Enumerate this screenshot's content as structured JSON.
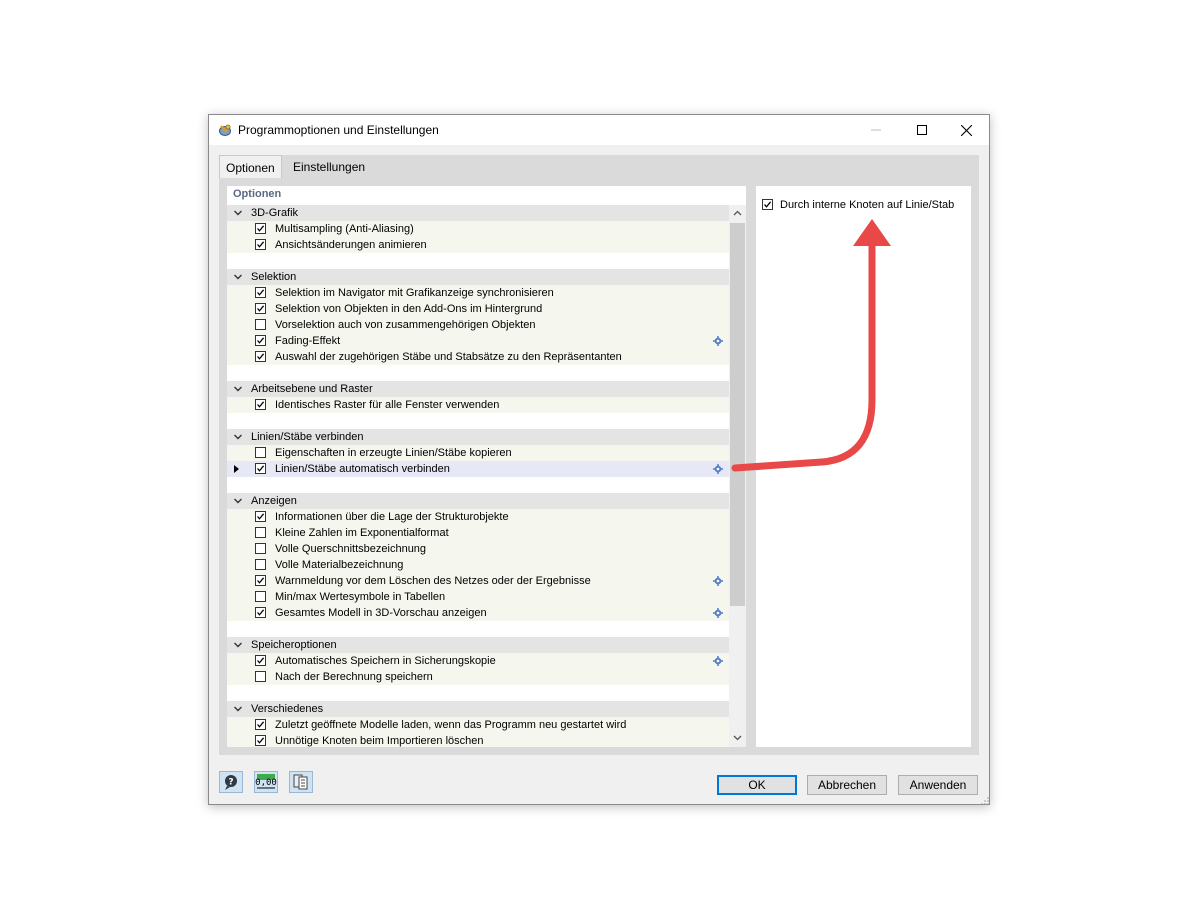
{
  "window": {
    "title": "Programmoptionen und Einstellungen"
  },
  "tabs": [
    {
      "label": "Optionen",
      "active": true
    },
    {
      "label": "Einstellungen",
      "active": false
    }
  ],
  "options_section_label": "Optionen",
  "groups": [
    {
      "title": "3D-Grafik",
      "items": [
        {
          "label": "Multisampling (Anti-Aliasing)",
          "checked": true,
          "gear": false
        },
        {
          "label": "Ansichtsänderungen animieren",
          "checked": true,
          "gear": false
        }
      ]
    },
    {
      "title": "Selektion",
      "items": [
        {
          "label": "Selektion im Navigator mit Grafikanzeige synchronisieren",
          "checked": true,
          "gear": false
        },
        {
          "label": "Selektion von Objekten in den Add-Ons im Hintergrund",
          "checked": true,
          "gear": false
        },
        {
          "label": "Vorselektion auch von zusammengehörigen Objekten",
          "checked": false,
          "gear": false
        },
        {
          "label": "Fading-Effekt",
          "checked": true,
          "gear": true
        },
        {
          "label": "Auswahl der zugehörigen Stäbe und Stabsätze zu den Repräsentanten",
          "checked": true,
          "gear": false
        }
      ]
    },
    {
      "title": "Arbeitsebene und Raster",
      "items": [
        {
          "label": "Identisches Raster für alle Fenster verwenden",
          "checked": true,
          "gear": false
        }
      ]
    },
    {
      "title": "Linien/Stäbe verbinden",
      "items": [
        {
          "label": "Eigenschaften in erzeugte Linien/Stäbe kopieren",
          "checked": false,
          "gear": false
        },
        {
          "label": "Linien/Stäbe automatisch verbinden",
          "checked": true,
          "gear": true,
          "current": true
        }
      ]
    },
    {
      "title": "Anzeigen",
      "items": [
        {
          "label": "Informationen über die Lage der Strukturobjekte",
          "checked": true,
          "gear": false
        },
        {
          "label": "Kleine Zahlen im Exponentialformat",
          "checked": false,
          "gear": false
        },
        {
          "label": "Volle Querschnittsbezeichnung",
          "checked": false,
          "gear": false
        },
        {
          "label": "Volle Materialbezeichnung",
          "checked": false,
          "gear": false
        },
        {
          "label": "Warnmeldung vor dem Löschen des Netzes oder der Ergebnisse",
          "checked": true,
          "gear": true
        },
        {
          "label": "Min/max Wertesymbole in Tabellen",
          "checked": false,
          "gear": false
        },
        {
          "label": "Gesamtes Modell in 3D-Vorschau anzeigen",
          "checked": true,
          "gear": true
        }
      ]
    },
    {
      "title": "Speicheroptionen",
      "items": [
        {
          "label": "Automatisches Speichern in Sicherungskopie",
          "checked": true,
          "gear": true
        },
        {
          "label": "Nach der Berechnung speichern",
          "checked": false,
          "gear": false
        }
      ]
    },
    {
      "title": "Verschiedenes",
      "items": [
        {
          "label": "Zuletzt geöffnete Modelle laden, wenn das Programm neu gestartet wird",
          "checked": true,
          "gear": false
        },
        {
          "label": "Unnötige Knoten beim Importieren löschen",
          "checked": true,
          "gear": false
        }
      ]
    }
  ],
  "right_panel": {
    "label": "Durch interne Knoten auf Linie/Stab",
    "checked": true
  },
  "footer": {
    "units_icon_text": "0,00",
    "ok": "OK",
    "cancel": "Abbrechen",
    "apply": "Anwenden"
  },
  "colors": {
    "accent": "#0078d7",
    "arrow": "#e84848",
    "section_label": "#5a6a82"
  },
  "icons": [
    "app-icon",
    "minimize-icon",
    "maximize-icon",
    "close-icon",
    "chevron-down-icon",
    "checkmark-icon",
    "gear-icon",
    "scroll-up-icon",
    "scroll-down-icon",
    "help-icon",
    "units-icon",
    "copy-settings-icon",
    "resize-grip-icon"
  ]
}
